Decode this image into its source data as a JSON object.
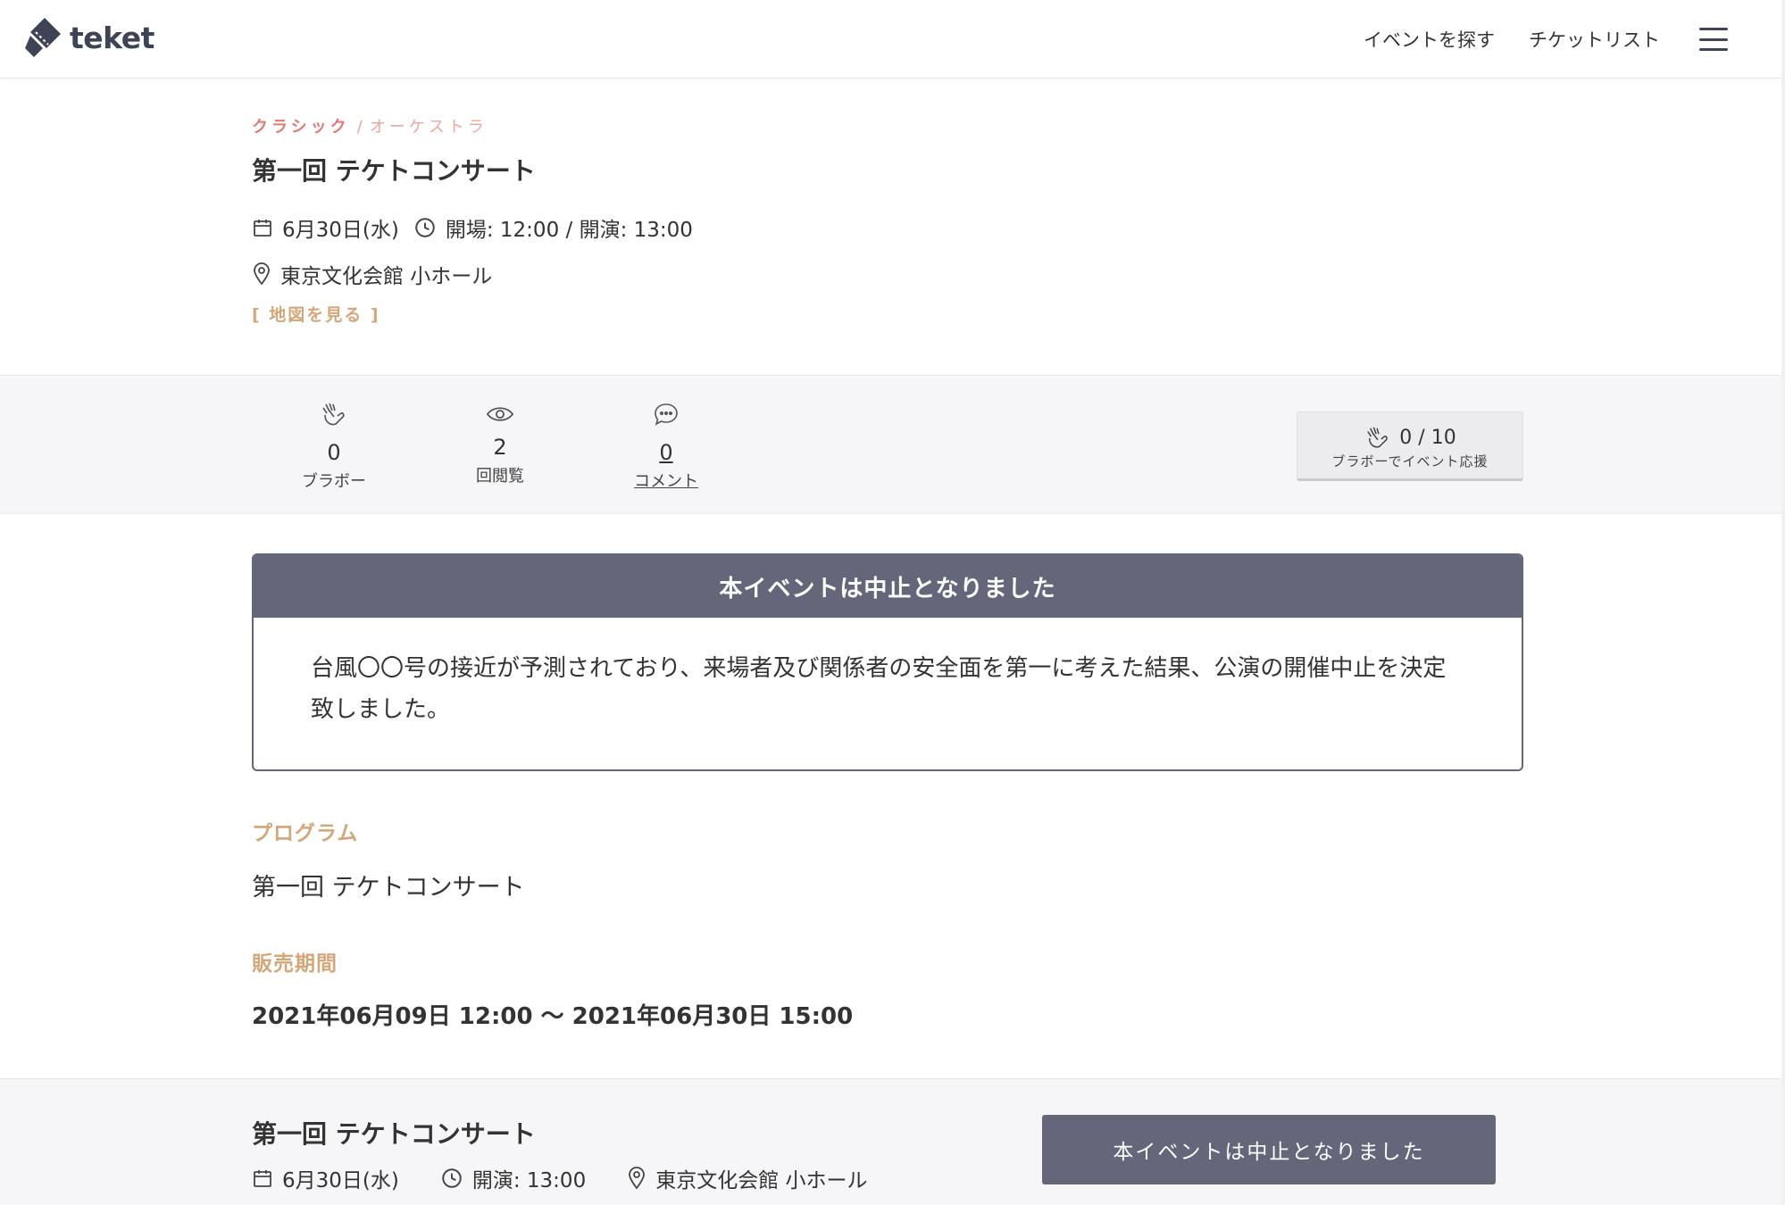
{
  "header": {
    "logo_text": "teket",
    "nav": {
      "find_events": "イベントを探す",
      "ticket_list": "チケットリスト"
    }
  },
  "event": {
    "category_main": "クラシック",
    "category_separator": "/",
    "category_sub": "オーケストラ",
    "title": "第一回 テケトコンサート",
    "date": "6月30日(水)",
    "time": "開場: 12:00 / 開演: 13:00",
    "venue": "東京文化会館 小ホール",
    "map_link": "[ 地図を見る ]"
  },
  "stats": {
    "bravo_count": "0",
    "bravo_label": "ブラボー",
    "views_count": "2",
    "views_label": "回閲覧",
    "comments_count": "0",
    "comments_label": "コメント",
    "support_progress": "0 / 10",
    "support_label": "ブラボーでイベント応援"
  },
  "notice": {
    "title": "本イベントは中止となりました",
    "body": "台風〇〇号の接近が予測されており、来場者及び関係者の安全面を第一に考えた結果、公演の開催中止を決定致しました。"
  },
  "program": {
    "title": "プログラム",
    "text": "第一回 テケトコンサート"
  },
  "sales": {
    "title": "販売期間",
    "text": "2021年06月09日 12:00 〜 2021年06月30日 15:00"
  },
  "footer": {
    "title": "第一回 テケトコンサート",
    "date": "6月30日(水)",
    "time": "開演: 13:00",
    "venue": "東京文化会館 小ホール",
    "button_label": "本イベントは中止となりました"
  },
  "colors": {
    "brand": "#3e4456",
    "category_red": "#e07a73",
    "accent_gold": "#d4a77a",
    "notice_slate": "#636779"
  }
}
